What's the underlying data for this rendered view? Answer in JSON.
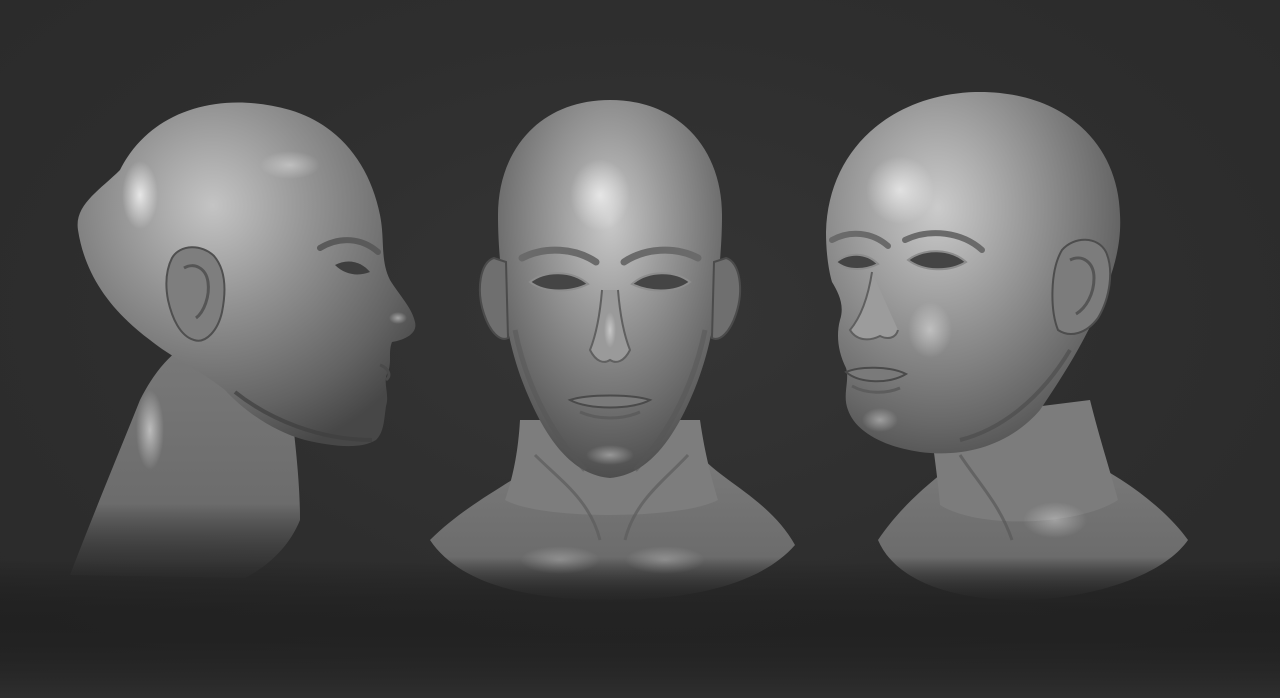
{
  "scene": {
    "background_color": "#2f2f2f",
    "material_color": "#8a8a8a",
    "views": [
      {
        "name": "side-profile-view",
        "facing": "right"
      },
      {
        "name": "front-view",
        "facing": "front"
      },
      {
        "name": "three-quarter-view",
        "facing": "left"
      }
    ]
  }
}
